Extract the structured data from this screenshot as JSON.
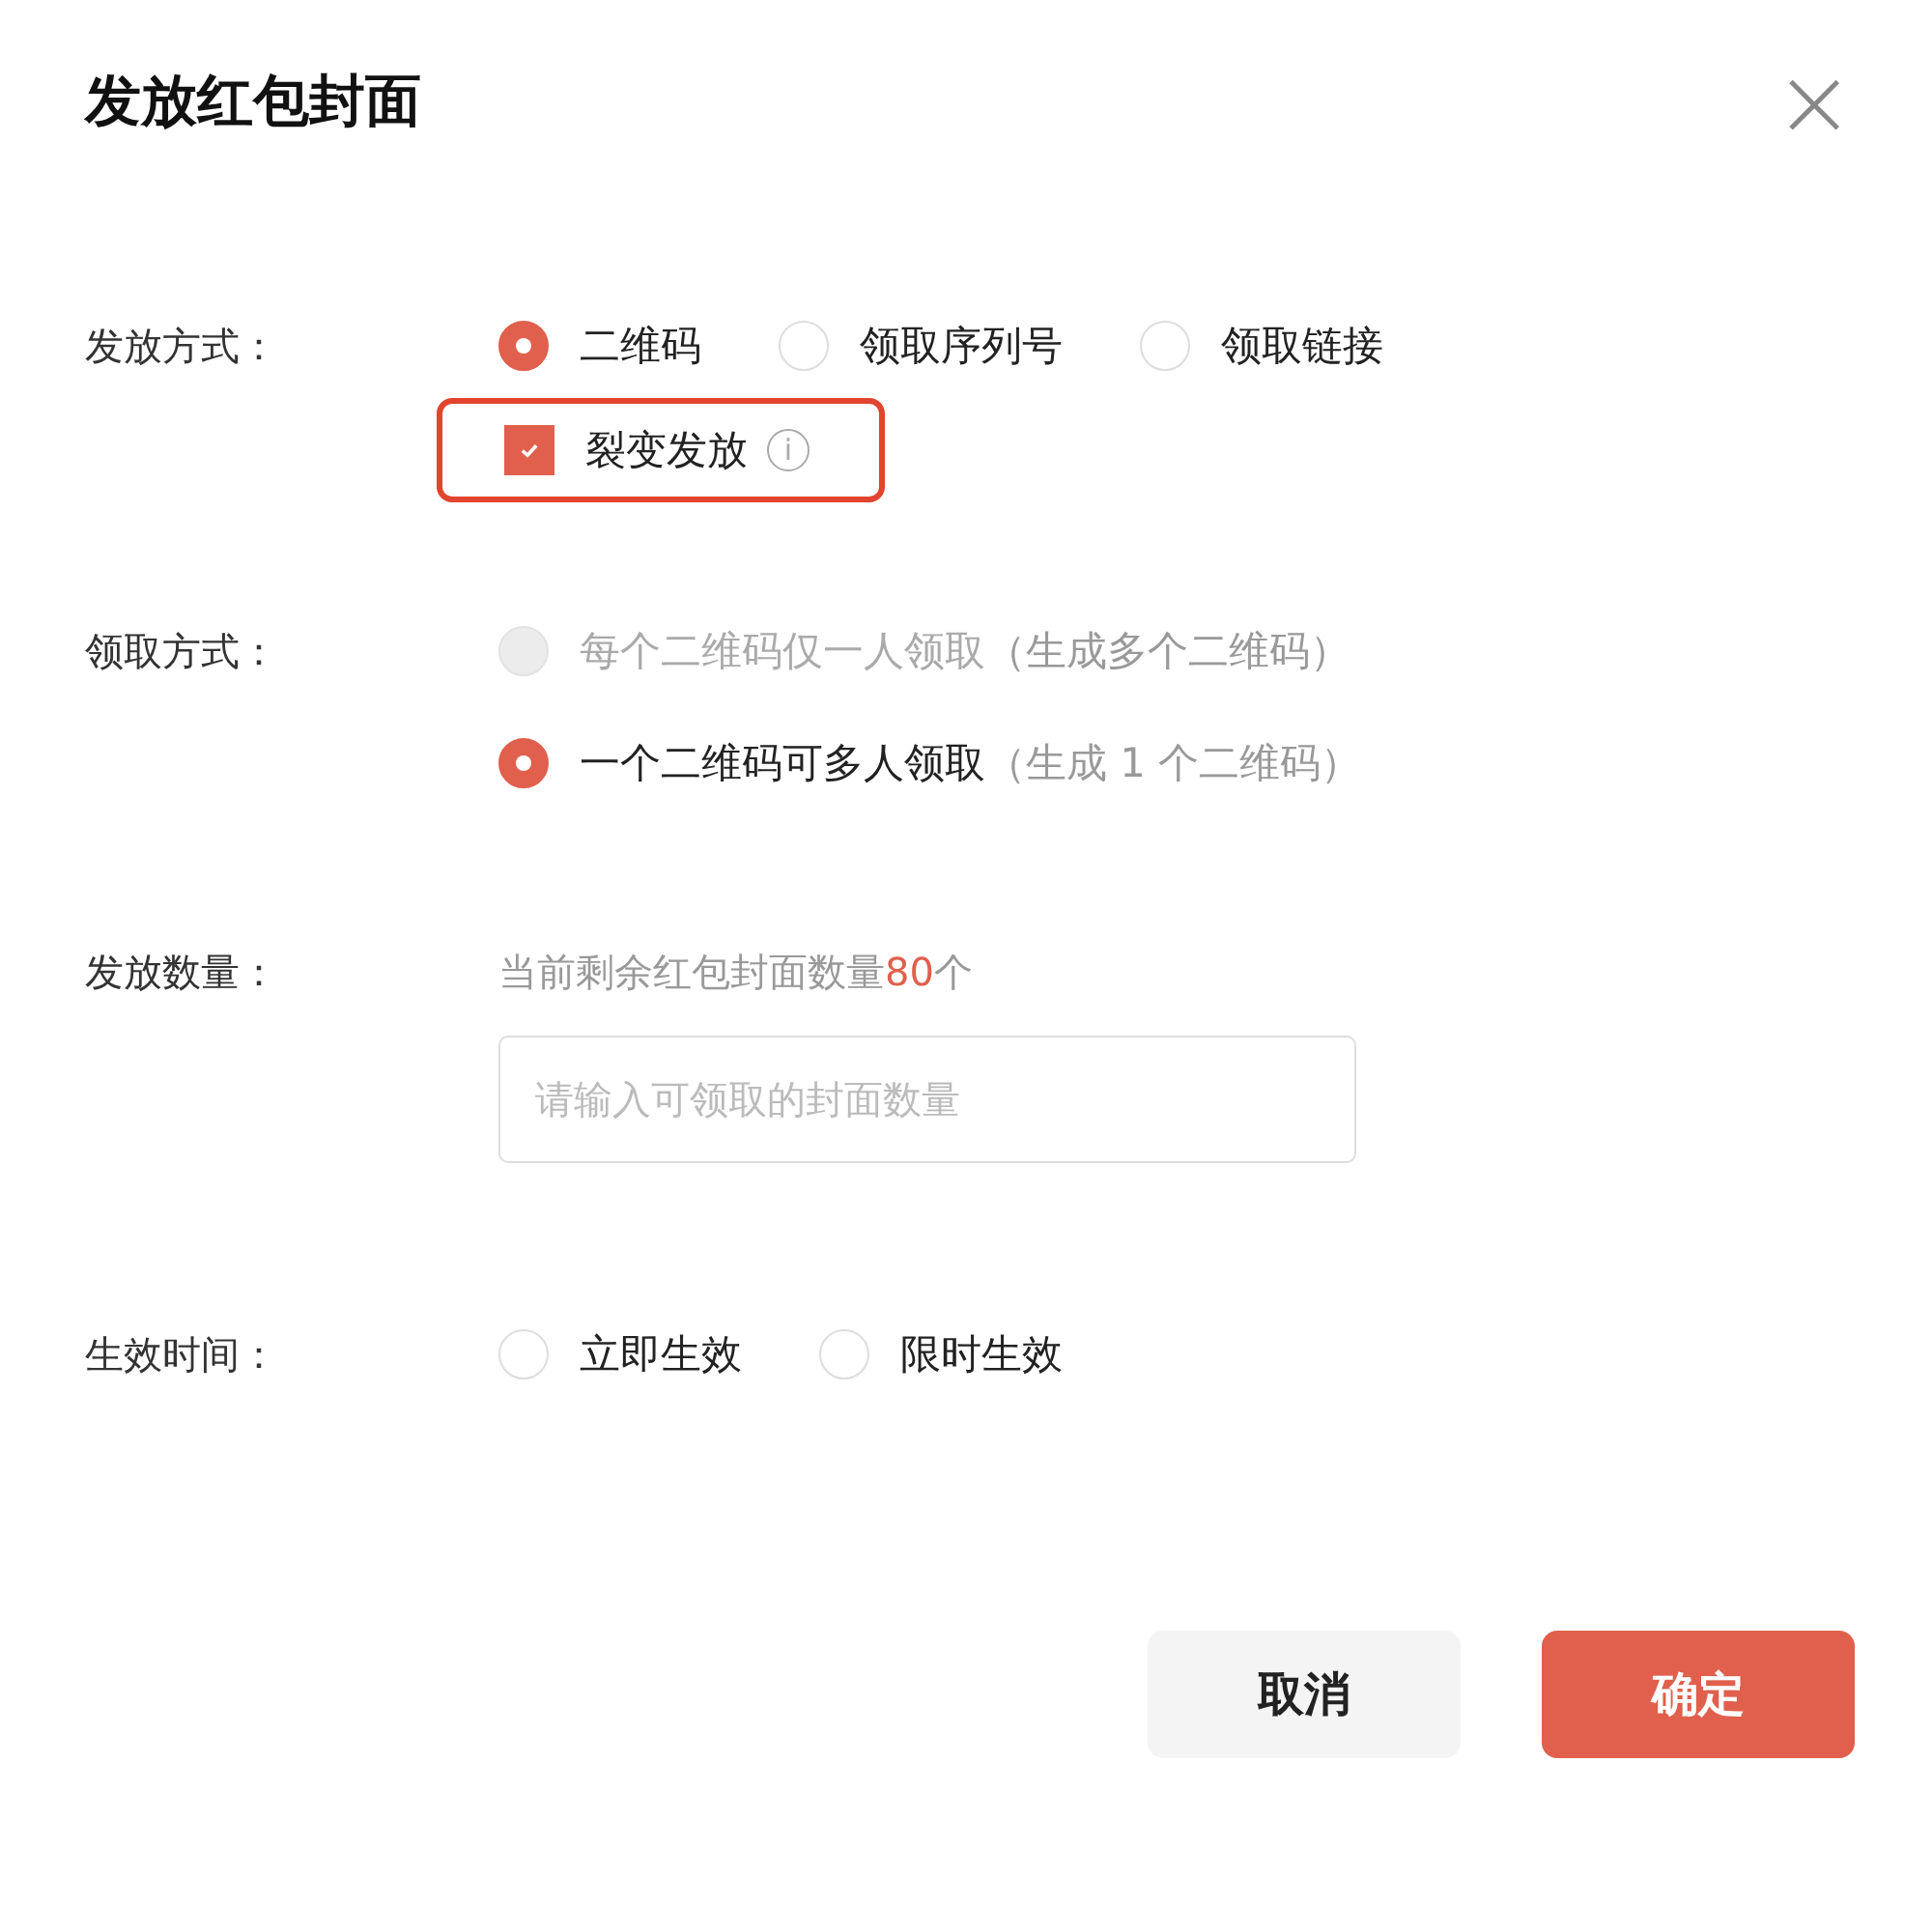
{
  "dialog": {
    "title": "发放红包封面",
    "close": "×"
  },
  "sections": [
    {
      "label": "发放方式：",
      "kind": "radios",
      "options": [
        {
          "label": "二维码",
          "selected": true,
          "disabled": false
        },
        {
          "label": "领取序列号",
          "selected": false,
          "disabled": false
        },
        {
          "label": "领取链接",
          "selected": false,
          "disabled": false
        }
      ],
      "checkbox": {
        "label": "裂变发放",
        "checked": true,
        "highlighted": true,
        "info": "i"
      }
    },
    {
      "label": "领取方式：",
      "kind": "stacked_radios",
      "options": [
        {
          "label": "每个二维码仅一人领取",
          "note": "（生成多个二维码）",
          "selected": false,
          "disabled": true
        },
        {
          "label": "一个二维码可多人领取",
          "note": "（生成 1 个二维码）",
          "selected": true,
          "disabled": false
        }
      ]
    },
    {
      "label": "发放数量：",
      "kind": "input",
      "hint_prefix": "当前剩余红包封面数量",
      "hint_count": "80",
      "hint_suffix": "个",
      "placeholder": "请输入可领取的封面数量"
    },
    {
      "label": "生效时间：",
      "kind": "radios",
      "options": [
        {
          "label": "立即生效",
          "selected": false,
          "disabled": false
        },
        {
          "label": "限时生效",
          "selected": false,
          "disabled": false
        }
      ]
    }
  ],
  "buttons": [
    {
      "label": "取消",
      "kind": "secondary"
    },
    {
      "label": "确定",
      "kind": "primary"
    }
  ]
}
